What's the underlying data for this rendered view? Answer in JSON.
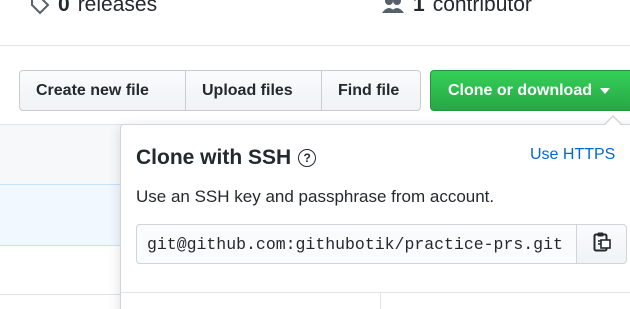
{
  "stats": {
    "releases_count": "0",
    "releases_label": "releases",
    "contributors_count": "1",
    "contributors_label": "contributor"
  },
  "toolbar": {
    "create_file_label": "Create new file",
    "upload_files_label": "Upload files",
    "find_file_label": "Find file",
    "clone_label": "Clone or download"
  },
  "clone_panel": {
    "title": "Clone with SSH",
    "help_icon": "?",
    "switch_link": "Use HTTPS",
    "description": "Use an SSH key and passphrase from account.",
    "url_value": "git@github.com:githubotik/practice-prs.git",
    "copy_icon": "clipboard-icon"
  },
  "colors": {
    "clone_button": "#28a745",
    "link": "#0366d6",
    "selected_row": "#f1f8ff"
  }
}
